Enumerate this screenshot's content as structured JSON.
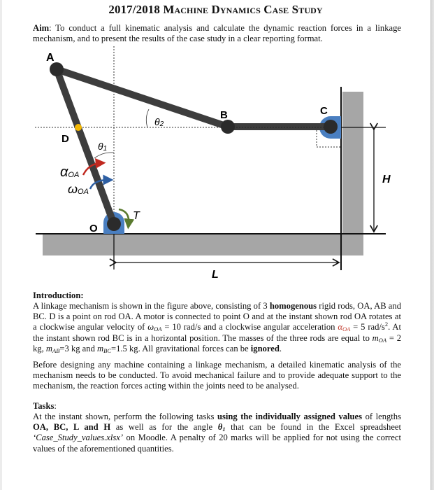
{
  "document": {
    "title_year": "2017/2018",
    "title_words": [
      "Machine",
      "Dynamics",
      "Case",
      "Study"
    ],
    "aim": {
      "label": "Aim",
      "text": ": To conduct a full kinematic analysis and calculate the dynamic reaction forces in a linkage mechanism, and to present the results of the case study in a clear reporting format."
    },
    "figure": {
      "labels": {
        "A": "A",
        "B": "B",
        "C": "C",
        "D": "D",
        "O": "O",
        "theta1": "θ",
        "theta1_sub": "1",
        "theta2": "θ",
        "theta2_sub": "2",
        "alpha": "α",
        "alpha_sub": "OA",
        "omega": "ω",
        "omega_sub": "OA",
        "torque": "T",
        "L": "L",
        "H": "H"
      },
      "colors": {
        "rod": "#3d3d3d",
        "joint": "#2b2b2b",
        "point_d": "#f2b705",
        "support": "#4a7fc1",
        "ground": "#a6a6a6",
        "alpha_arrow": "#c0281f",
        "omega_arrow": "#2e5fa3",
        "torque_arrow": "#5a7a2e"
      }
    },
    "introduction": {
      "heading": "Introduction:",
      "t1": "A linkage mechanism is shown in the figure above, consisting of 3 ",
      "b1": "homogenous",
      "t2": " rigid rods, OA, AB and BC. D is a point on rod OA. A motor is connected to point O and at the instant shown rod OA rotates at a clockwise angular velocity of ",
      "omega_sym": "ω",
      "omega_sub": "OA",
      "omega_val": " = 10 rad/s",
      "t3": " and a clockwise angular acceleration ",
      "alpha_sym": "α",
      "alpha_sub": "OA",
      "alpha_val": " = 5 rad/s",
      "alpha_exp": "2",
      "t4": ". At the instant shown rod BC is in a horizontal position. The masses of the three rods are equal to ",
      "m_sym": "m",
      "m_oa_sub": "OA",
      "m_oa_val": " = 2 kg, ",
      "m_ab_sub": "AB",
      "m_ab_val": "=3 kg and ",
      "m_bc_sub": "BC",
      "m_bc_val": "=1.5 kg. All gravitational forces can be ",
      "b2": "ignored",
      "t5": "."
    },
    "before": "Before designing any machine containing a linkage mechanism, a detailed kinematic analysis of the mechanism needs to be conducted. To avoid mechanical failure and to provide adequate support to the mechanism, the reaction forces acting within the joints need to be analysed.",
    "tasks": {
      "heading": "Tasks",
      "colon": ":",
      "t1": "At the instant shown, perform the following tasks ",
      "b1": "using the individually assigned values",
      "t2": " of lengths ",
      "b2": "OA, BC, L and H",
      "t3": " as well as for the angle ",
      "theta": "θ",
      "theta_sub": "1",
      "t4": " that can be found in the Excel spreadsheet ",
      "file": "‘Case_Study_values.xlsx’",
      "t5": " on Moodle. A penalty of 20 marks will be applied for not using the correct values of the aforementioned quantities."
    }
  }
}
